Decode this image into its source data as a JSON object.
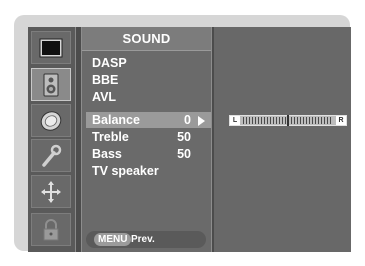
{
  "menu": {
    "title": "SOUND",
    "items": [
      {
        "label": "DASP",
        "value": ""
      },
      {
        "label": "BBE",
        "value": ""
      },
      {
        "label": "AVL",
        "value": ""
      },
      {
        "label": "Balance",
        "value": "0"
      },
      {
        "label": "Treble",
        "value": "50"
      },
      {
        "label": "Bass",
        "value": "50"
      },
      {
        "label": "TV speaker",
        "value": ""
      }
    ],
    "selected_index": 3,
    "footer": {
      "key": "MENU",
      "text": "Prev."
    }
  },
  "side_icons": [
    {
      "name": "picture-icon",
      "active": false
    },
    {
      "name": "speaker-icon",
      "active": true
    },
    {
      "name": "clock-icon",
      "active": false
    },
    {
      "name": "wrench-icon",
      "active": false
    },
    {
      "name": "screen-adjust-icon",
      "active": false
    },
    {
      "name": "lock-icon",
      "active": false
    }
  ],
  "balance_bar": {
    "left_label": "L",
    "right_label": "R",
    "value": 0,
    "range": [
      -50,
      50
    ]
  },
  "colors": {
    "osd_background": "#4c4c4c",
    "highlight": "#9a9a9a",
    "text": "#ffffff"
  }
}
